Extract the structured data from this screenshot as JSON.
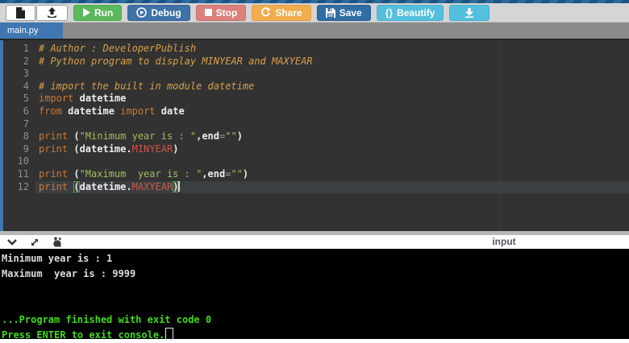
{
  "toolbar": {
    "run": {
      "label": "Run"
    },
    "debug": {
      "label": "Debug"
    },
    "stop": {
      "label": "Stop"
    },
    "share": {
      "label": "Share"
    },
    "save": {
      "label": "Save"
    },
    "beautify": {
      "label": "Beautify",
      "icon_glyph": "{}"
    }
  },
  "tabs": [
    {
      "label": "main.py",
      "active": true
    }
  ],
  "editor": {
    "active_line": 12,
    "lines": [
      [
        [
          "c",
          "# Author : DeveloperPublish"
        ]
      ],
      [
        [
          "c",
          "# Python program to display MINYEAR and MAXYEAR"
        ]
      ],
      [],
      [
        [
          "c",
          "# import the built in module datetime"
        ]
      ],
      [
        [
          "k",
          "import"
        ],
        [
          "p",
          " "
        ],
        [
          "i",
          "datetime"
        ]
      ],
      [
        [
          "k",
          "from"
        ],
        [
          "p",
          " "
        ],
        [
          "i",
          "datetime"
        ],
        [
          "p",
          " "
        ],
        [
          "k",
          "import"
        ],
        [
          "p",
          " "
        ],
        [
          "i",
          "date"
        ]
      ],
      [],
      [
        [
          "k",
          "print"
        ],
        [
          "p",
          " ("
        ],
        [
          "s",
          "\"Minimum year is : \""
        ],
        [
          "p",
          ","
        ],
        [
          "i",
          "end"
        ],
        [
          "o",
          "="
        ],
        [
          "s",
          "\"\""
        ],
        [
          "p",
          ")"
        ]
      ],
      [
        [
          "k",
          "print"
        ],
        [
          "p",
          " ("
        ],
        [
          "i",
          "datetime"
        ],
        [
          "p",
          "."
        ],
        [
          "x",
          "MINYEAR"
        ],
        [
          "p",
          ")"
        ]
      ],
      [],
      [
        [
          "k",
          "print"
        ],
        [
          "p",
          " ("
        ],
        [
          "s",
          "\"Maximum  year is : \""
        ],
        [
          "p",
          ","
        ],
        [
          "i",
          "end"
        ],
        [
          "o",
          "="
        ],
        [
          "s",
          "\"\""
        ],
        [
          "p",
          ")"
        ]
      ],
      [
        [
          "k",
          "print"
        ],
        [
          "p",
          " "
        ],
        [
          "b",
          "("
        ],
        [
          "i",
          "datetime"
        ],
        [
          "p",
          "."
        ],
        [
          "x",
          "MAXYEAR"
        ],
        [
          "b",
          ")"
        ],
        [
          "cur",
          ""
        ]
      ]
    ]
  },
  "console_bar": {
    "input_label": "input"
  },
  "console": {
    "lines": [
      {
        "text": "Minimum year is : 1",
        "color": "white"
      },
      {
        "text": "Maximum  year is : 9999",
        "color": "white"
      },
      {
        "text": "",
        "color": "white"
      },
      {
        "text": "",
        "color": "white"
      },
      {
        "text": "...Program finished with exit code 0",
        "color": "green"
      },
      {
        "text": "Press ENTER to exit console.",
        "color": "green",
        "cursor": true
      }
    ]
  },
  "colors": {
    "run_green": "#5cb85c",
    "debug_blue": "#3d71a8",
    "stop_red": "#db807b",
    "share_orange": "#f0ad4e",
    "save_blue": "#2f6da4",
    "beautify_teal": "#54bfdd",
    "tab_blue": "#4077b2",
    "editor_bg": "#323232",
    "keyword": "#cc7832",
    "comment": "#d7a04a",
    "string": "#a0bf5e",
    "constant": "#cf5647",
    "console_green": "#3fdc1c"
  }
}
